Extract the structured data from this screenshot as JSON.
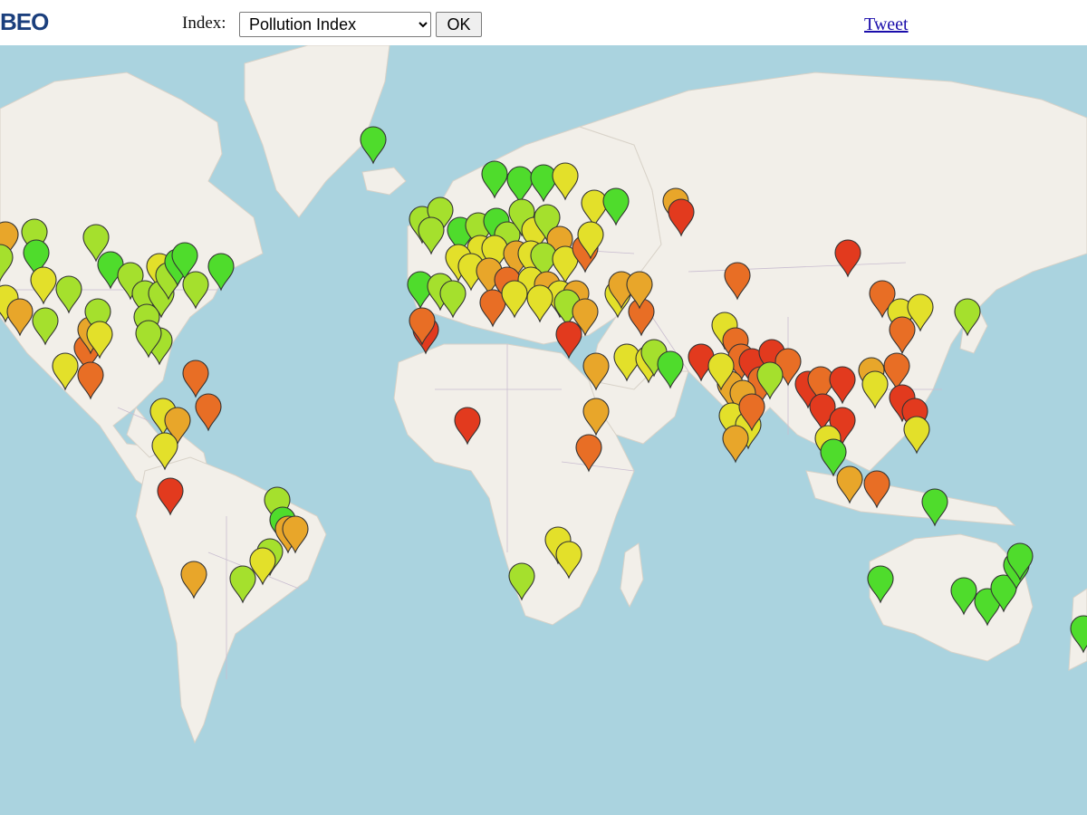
{
  "header": {
    "logo_text": "BEO",
    "index_label": "Index:",
    "index_options": [
      "Pollution Index"
    ],
    "index_selected": "Pollution Index",
    "ok_label": "OK",
    "tweet_label": "Tweet"
  },
  "map": {
    "colors": {
      "ocean": "#aad3df",
      "land": "#f2efe9",
      "ice": "#f8f8f8",
      "border": "#c9bdd0",
      "marker_stroke": "#333333"
    },
    "pollution_level_colors": {
      "very_low": "#4fdc2c",
      "low": "#a5e02d",
      "moderate": "#e3e02a",
      "high": "#e8a62a",
      "very_high": "#e86e25",
      "extreme": "#e23a1e"
    },
    "markers_note": "Each map pin represents a city; color indicates its pollution level."
  }
}
